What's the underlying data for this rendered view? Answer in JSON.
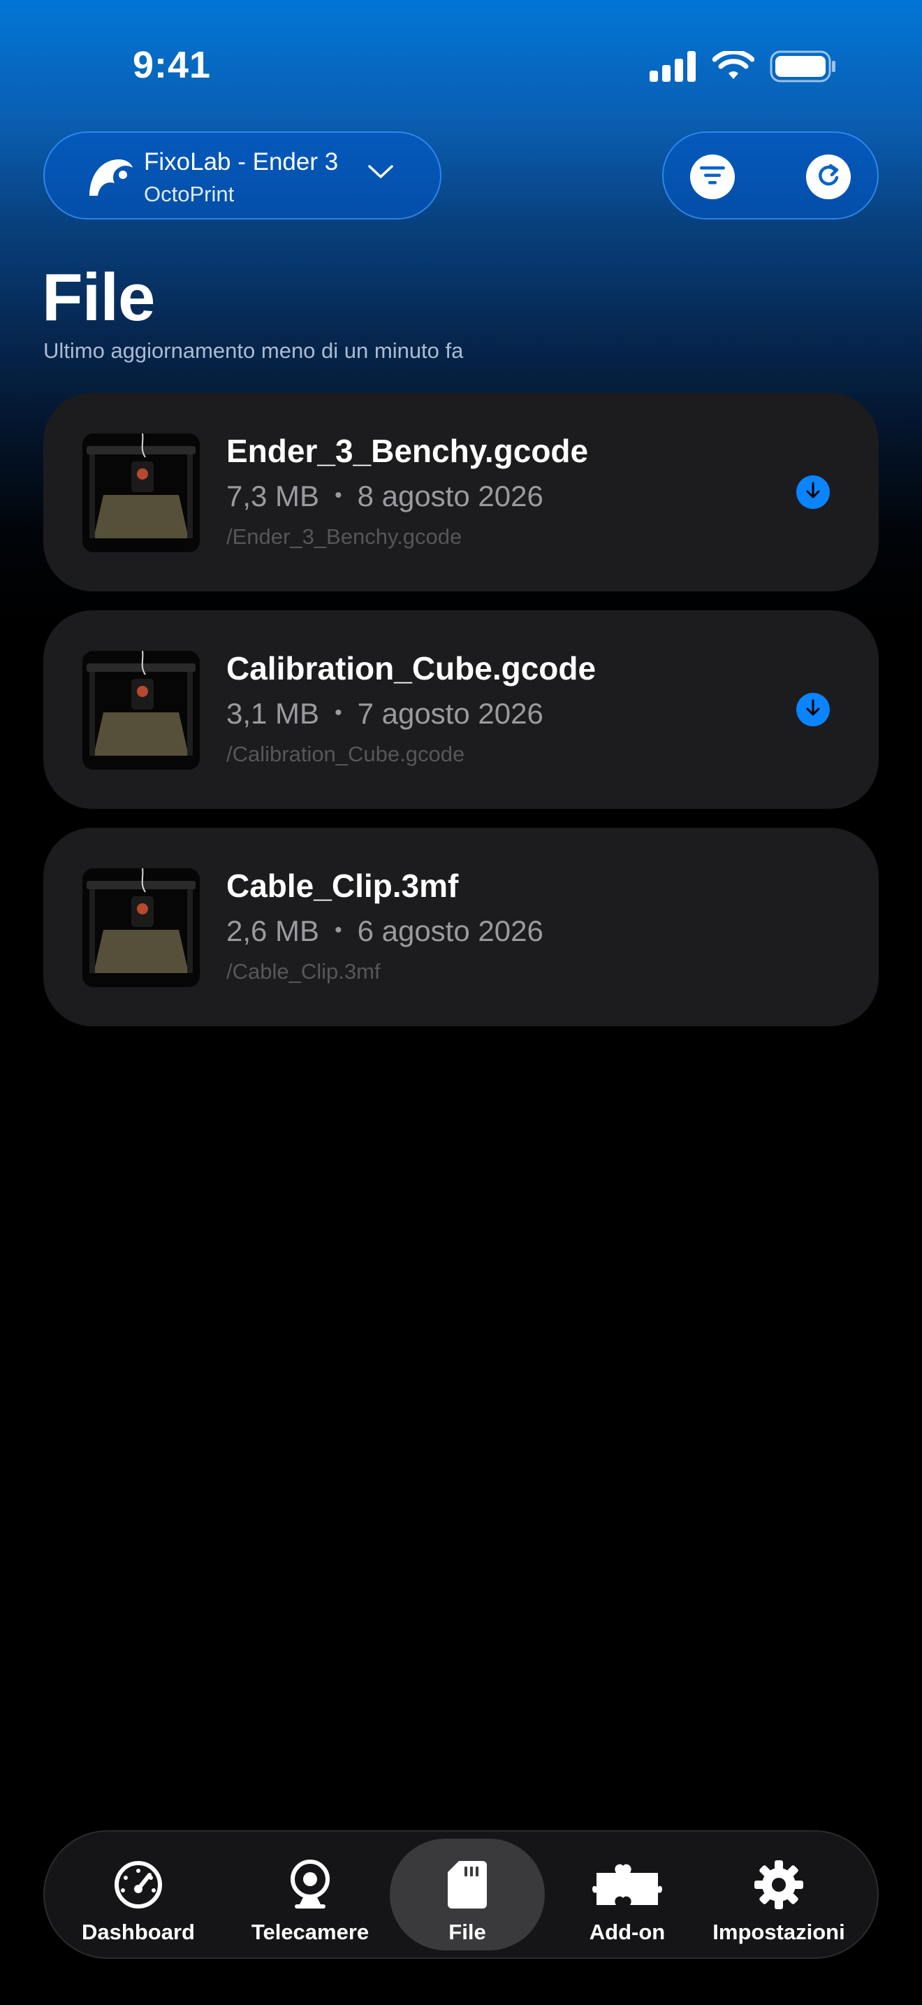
{
  "status_bar": {
    "time": "9:41",
    "icons": [
      "cellular-signal-icon",
      "wifi-icon",
      "battery-icon"
    ]
  },
  "header": {
    "printer_name": "FixoLab - Ender 3",
    "printer_type": "OctoPrint",
    "icons": [
      "octoprint-logo-icon",
      "chevron-down-icon",
      "filter-icon",
      "refresh-icon"
    ]
  },
  "page": {
    "title": "File",
    "subtitle": "Ultimo aggiornamento meno di un minuto fa"
  },
  "files": [
    {
      "name": "Ender_3_Benchy.gcode",
      "size": "7,3 MB",
      "date": "8 agosto 2026",
      "path": "/Ender_3_Benchy.gcode",
      "downloadable": true
    },
    {
      "name": "Calibration_Cube.gcode",
      "size": "3,1 MB",
      "date": "7 agosto 2026",
      "path": "/Calibration_Cube.gcode",
      "downloadable": true
    },
    {
      "name": "Cable_Clip.3mf",
      "size": "2,6 MB",
      "date": "6 agosto 2026",
      "path": "/Cable_Clip.3mf",
      "downloadable": false
    }
  ],
  "meta_separator": "•",
  "tab_bar": {
    "active": "File",
    "tabs": [
      {
        "label": "Dashboard",
        "icon": "gauge-icon"
      },
      {
        "label": "Telecamere",
        "icon": "webcam-icon"
      },
      {
        "label": "File",
        "icon": "sd-card-icon"
      },
      {
        "label": "Add-on",
        "icon": "puzzle-icon"
      },
      {
        "label": "Impostazioni",
        "icon": "gear-icon"
      }
    ]
  },
  "colors": {
    "accent": "#0a84ff",
    "card": "#1c1c1e",
    "header_top": "#0276d6"
  }
}
